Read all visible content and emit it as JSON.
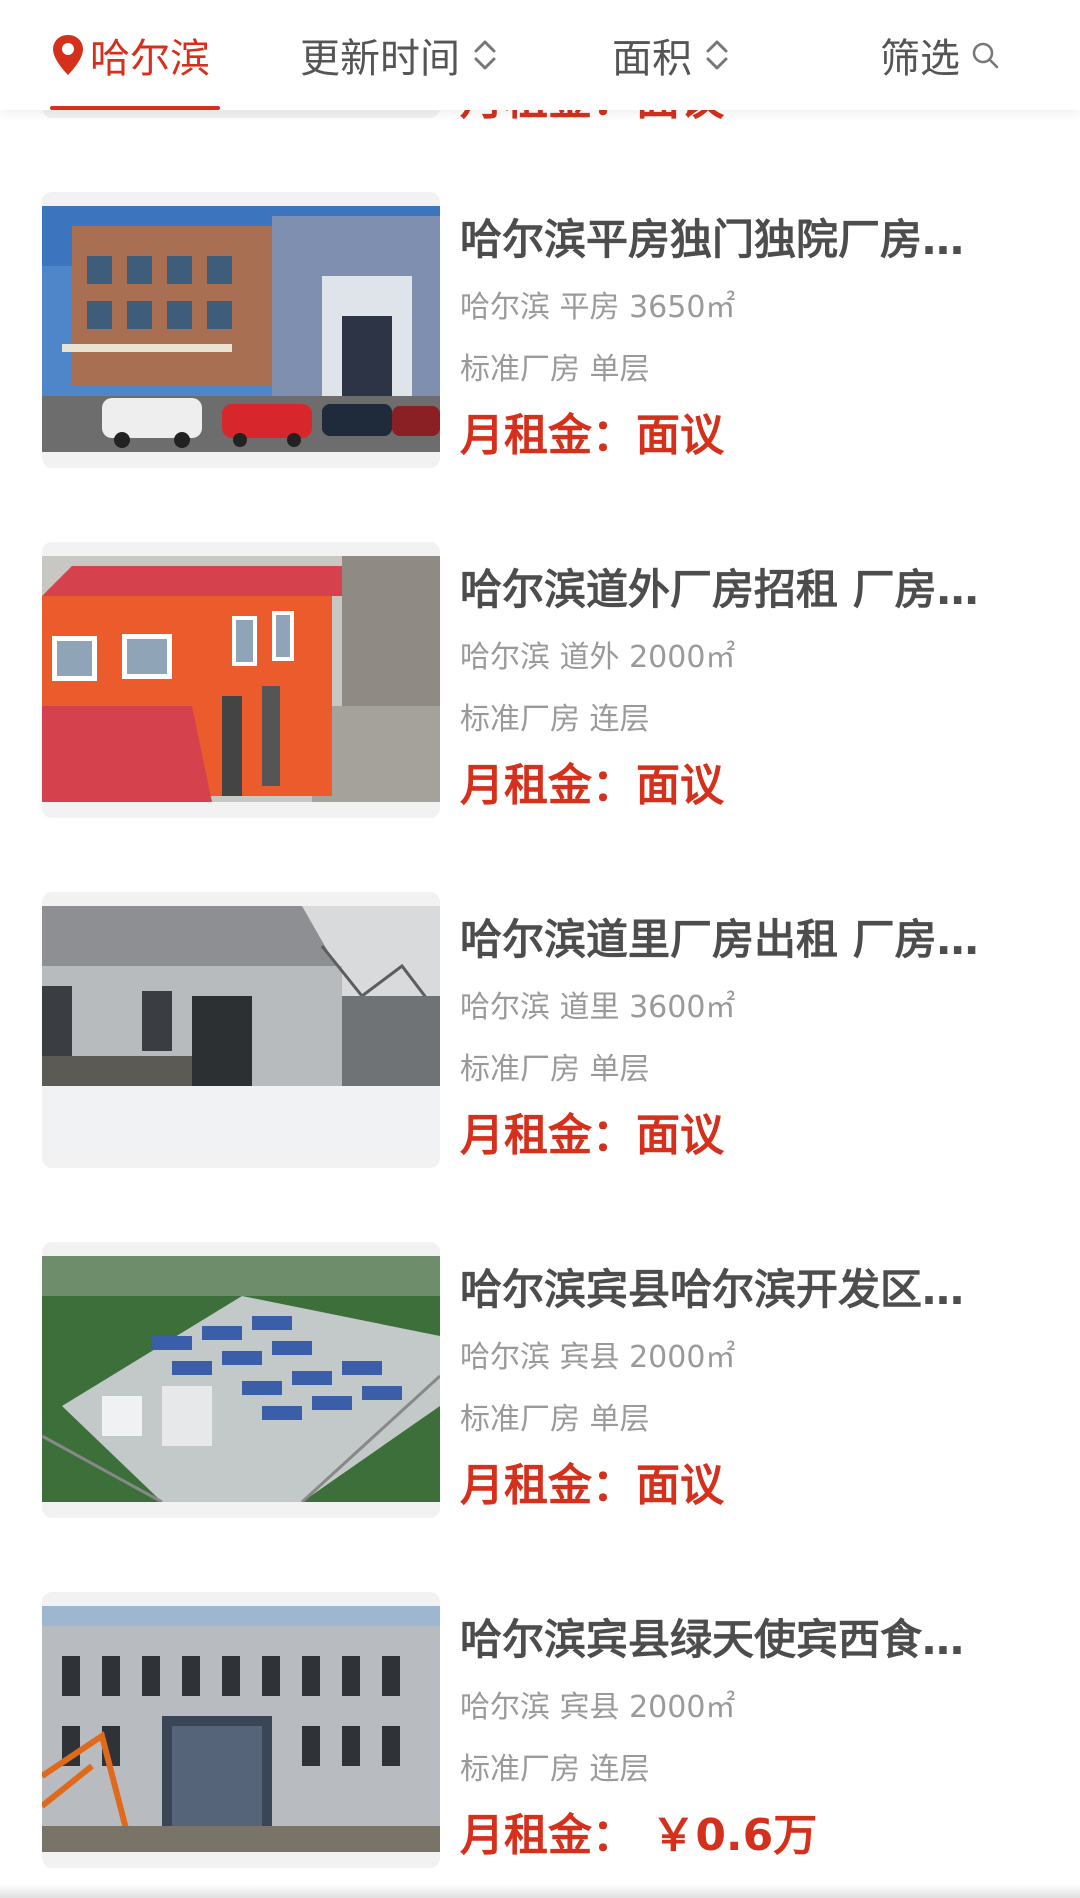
{
  "filter_bar": {
    "city": "哈尔滨",
    "sort_time": "更新时间",
    "sort_area": "面积",
    "filter": "筛选"
  },
  "previous_item": {
    "rent": "月租金：面议"
  },
  "listings": [
    {
      "title": "哈尔滨平房独门独院厂房…",
      "meta": "哈尔滨 平房 3650㎡",
      "type": "标准厂房 单层",
      "rent": "月租金：面议",
      "image": "factory-with-cars"
    },
    {
      "title": "哈尔滨道外厂房招租 厂房…",
      "meta": "哈尔滨 道外 2000㎡",
      "type": "标准厂房 连层",
      "rent": "月租金：面议",
      "image": "orange-building"
    },
    {
      "title": "哈尔滨道里厂房出租 厂房…",
      "meta": "哈尔滨 道里 3600㎡",
      "type": "标准厂房 单层",
      "rent": "月租金：面议",
      "image": "snowy-warehouse"
    },
    {
      "title": "哈尔滨宾县哈尔滨开发区…",
      "meta": "哈尔滨 宾县 2000㎡",
      "type": "标准厂房 单层",
      "rent": "月租金：面议",
      "image": "industrial-park-aerial"
    },
    {
      "title": "哈尔滨宾县绿天使宾西食…",
      "meta": "哈尔滨 宾县 2000㎡",
      "type": "标准厂房 连层",
      "rent": "月租金： ￥0.6万",
      "image": "concrete-building-crane"
    }
  ],
  "colors": {
    "accent": "#d4301c",
    "title": "#4d4d4d",
    "meta": "#9a9a9a",
    "filter_text": "#555555"
  }
}
